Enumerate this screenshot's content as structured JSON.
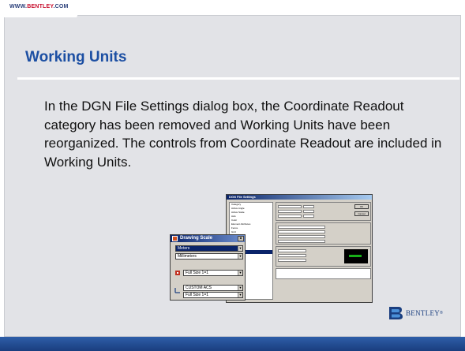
{
  "header": {
    "url_prefix": "WWW.",
    "url_brand": "BENTLEY",
    "url_suffix": ".COM"
  },
  "slide": {
    "title": "Working Units",
    "body": "In the DGN File Settings dialog box, the Coordinate Readout category has been removed and Working Units have been reorganized. The controls from Coordinate Readout are included in Working Units."
  },
  "dgn_dialog": {
    "title": "DGN File Settings",
    "categories": [
      "Category",
      "Active Angle",
      "Active Scale",
      "Axis",
      "Color",
      "Element Attributes",
      "Fence",
      "Grid",
      "Isometric",
      "Locks",
      "Snaps",
      "Views",
      "Working Units"
    ],
    "selected_category": "Working Units",
    "ok_label": "OK",
    "cancel_label": "Cancel"
  },
  "drawing_scale": {
    "title": "Drawing Scale",
    "master_unit": "Meters",
    "sub_unit": "Millimeters",
    "scale": "Full Size 1=1",
    "acs": "CUSTOM ACS",
    "acs_scale": "Full Size 1=1"
  },
  "logo": {
    "wordmark": "BENTLEY",
    "tm": "®"
  },
  "colors": {
    "title_blue": "#1c4fa3",
    "bar_blue": "#1a3e7f",
    "panel_gray": "#e2e3e7"
  }
}
